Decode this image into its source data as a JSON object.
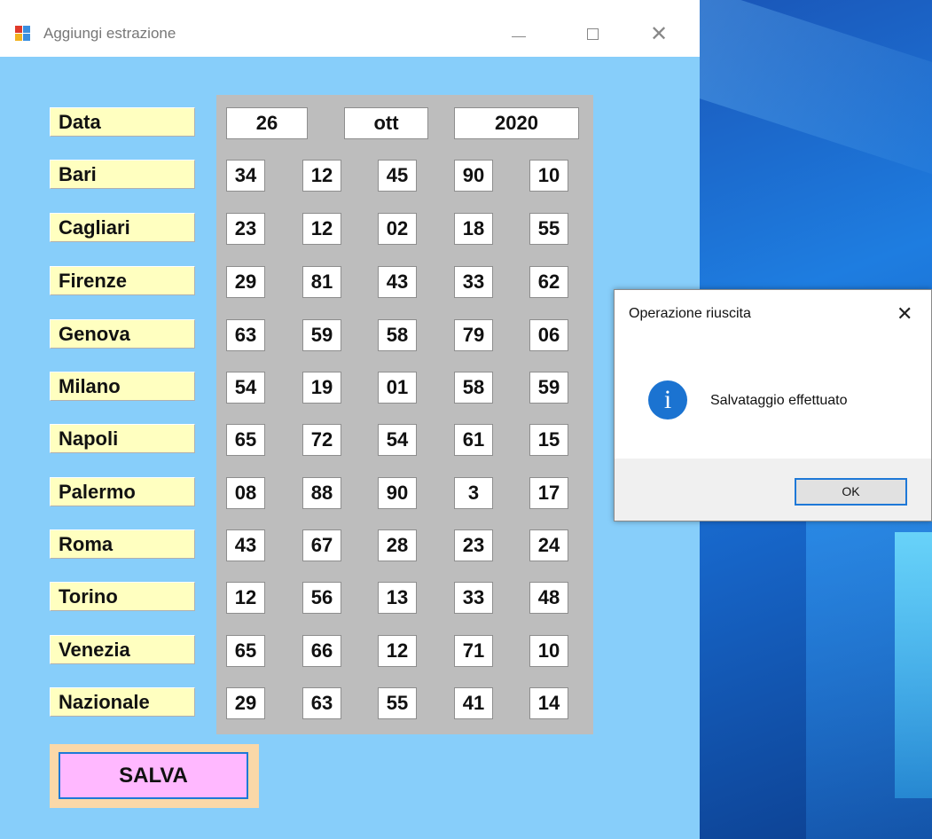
{
  "window": {
    "title": "Aggiungi estrazione",
    "controls": {
      "minimize": "—",
      "maximize": "☐",
      "close": "✕"
    }
  },
  "date": {
    "label": "Data",
    "day": "26",
    "month": "ott",
    "year": "2020"
  },
  "wheels": [
    {
      "name": "Bari",
      "numbers": [
        "34",
        "12",
        "45",
        "90",
        "10"
      ]
    },
    {
      "name": "Cagliari",
      "numbers": [
        "23",
        "12",
        "02",
        "18",
        "55"
      ]
    },
    {
      "name": "Firenze",
      "numbers": [
        "29",
        "81",
        "43",
        "33",
        "62"
      ]
    },
    {
      "name": "Genova",
      "numbers": [
        "63",
        "59",
        "58",
        "79",
        "06"
      ]
    },
    {
      "name": "Milano",
      "numbers": [
        "54",
        "19",
        "01",
        "58",
        "59"
      ]
    },
    {
      "name": "Napoli",
      "numbers": [
        "65",
        "72",
        "54",
        "61",
        "15"
      ]
    },
    {
      "name": "Palermo",
      "numbers": [
        "08",
        "88",
        "90",
        "3",
        "17"
      ]
    },
    {
      "name": "Roma",
      "numbers": [
        "43",
        "67",
        "28",
        "23",
        "24"
      ]
    },
    {
      "name": "Torino",
      "numbers": [
        "12",
        "56",
        "13",
        "33",
        "48"
      ]
    },
    {
      "name": "Venezia",
      "numbers": [
        "65",
        "66",
        "12",
        "71",
        "10"
      ]
    },
    {
      "name": "Nazionale",
      "numbers": [
        "29",
        "63",
        "55",
        "41",
        "14"
      ]
    }
  ],
  "save_button": {
    "label": "SALVA"
  },
  "dialog": {
    "title": "Operazione riuscita",
    "close": "✕",
    "icon": "info-icon",
    "icon_glyph": "i",
    "message": "Salvataggio effettuato",
    "ok_label": "OK"
  },
  "colors": {
    "window_bg": "#87cefa",
    "label_bg": "#ffffc0",
    "grid_bg": "#bdbdbd",
    "save_bg": "#ffb8ff",
    "save_frame": "#fad8a8",
    "accent": "#1e78d7"
  }
}
